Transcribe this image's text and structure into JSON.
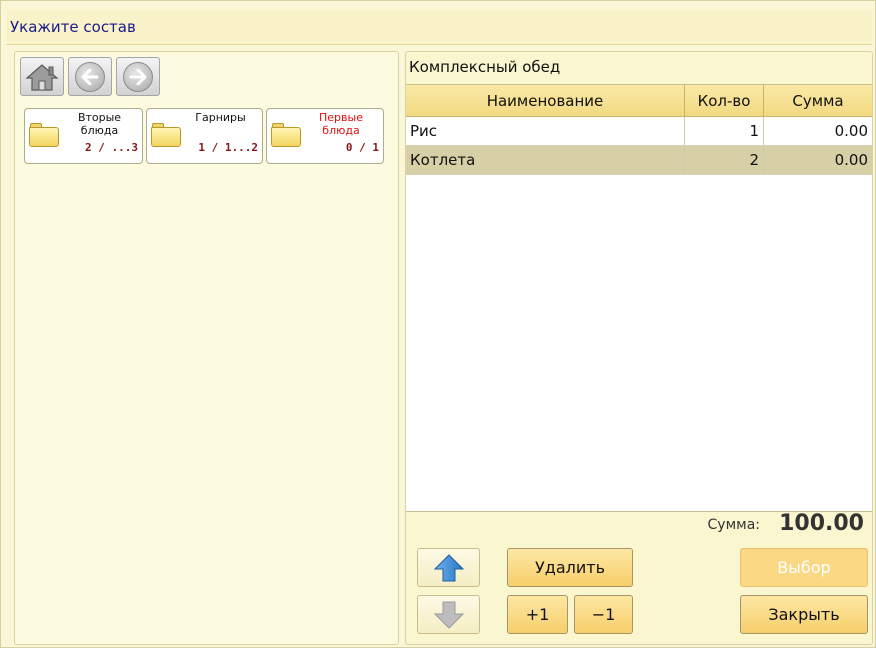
{
  "window": {
    "title": "Укажите состав"
  },
  "nav": {
    "home_icon": "home-icon",
    "back_icon": "arrow-left-icon",
    "forward_icon": "arrow-right-icon"
  },
  "folders": [
    {
      "name_line1": "Вторые",
      "name_line2": "блюда",
      "count": "2 / ...3",
      "color": "#111111"
    },
    {
      "name_line1": "Гарниры",
      "name_line2": "",
      "count": "1 / 1...2",
      "color": "#111111"
    },
    {
      "name_line1": "Первые",
      "name_line2": "блюда",
      "count": "0 / 1",
      "color": "#e01010"
    }
  ],
  "set": {
    "title": "Комплексный обед",
    "columns": [
      "Наименование",
      "Кол-во",
      "Сумма"
    ],
    "rows": [
      {
        "name": "Рис",
        "qty": "1",
        "sum": "0.00",
        "selected": false
      },
      {
        "name": "Котлета",
        "qty": "2",
        "sum": "0.00",
        "selected": true
      }
    ],
    "total_label": "Сумма:",
    "total_value": "100.00"
  },
  "buttons": {
    "up_icon": "arrow-up-icon",
    "down_icon": "arrow-down-icon",
    "delete": "Удалить",
    "plus_one": "+1",
    "minus_one": "−1",
    "select": "Выбор",
    "close": "Закрыть"
  },
  "colors": {
    "accent_blue": "#3b8fd6",
    "title_text": "#1a1a8c",
    "folder_count": "#8a1414"
  }
}
